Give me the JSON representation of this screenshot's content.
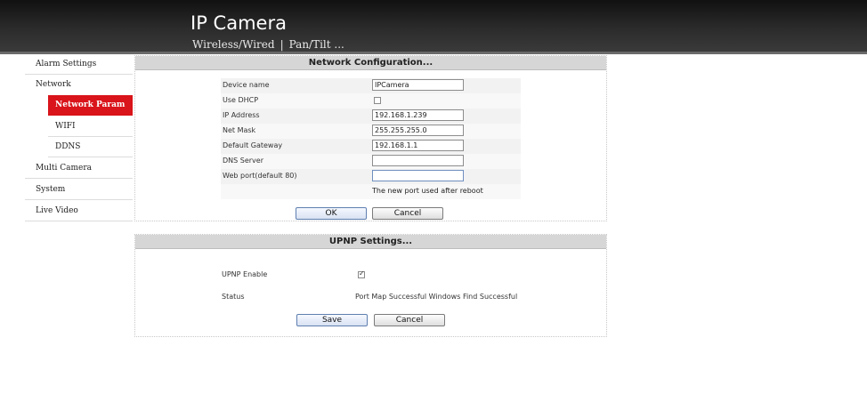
{
  "header": {
    "title": "IP Camera",
    "subnav": [
      "Wireless/Wired",
      "Pan/Tilt ..."
    ],
    "separator": "|"
  },
  "sidebar": {
    "items": [
      {
        "label": "Alarm Settings"
      },
      {
        "label": "Network"
      },
      {
        "label": "Network Param",
        "active": true
      },
      {
        "label": "WIFI"
      },
      {
        "label": "DDNS"
      },
      {
        "label": "Multi Camera"
      },
      {
        "label": "System"
      },
      {
        "label": "Live Video"
      }
    ]
  },
  "network": {
    "title": "Network Configuration...",
    "fields": {
      "device_name": {
        "label": "Device name",
        "value": "IPCamera"
      },
      "use_dhcp": {
        "label": "Use DHCP",
        "checked": false
      },
      "ip_address": {
        "label": "IP Address",
        "value": "192.168.1.239"
      },
      "net_mask": {
        "label": "Net Mask",
        "value": "255.255.255.0"
      },
      "gateway": {
        "label": "Default Gateway",
        "value": "192.168.1.1"
      },
      "dns": {
        "label": "DNS Server",
        "value": ""
      },
      "web_port": {
        "label": "Web port(default 80)",
        "value": ""
      }
    },
    "port_note": "The new port used after reboot",
    "ok_label": "OK",
    "cancel_label": "Cancel"
  },
  "upnp": {
    "title": "UPNP Settings...",
    "enable_label": "UPNP Enable",
    "enabled": true,
    "status_label": "Status",
    "status_value": "Port Map Successful Windows Find Successful",
    "save_label": "Save",
    "cancel_label": "Cancel"
  },
  "colors": {
    "active_nav": "#d9141a",
    "header_bg": "#1e1e1e",
    "panel_title_bg": "#d6d6d6"
  }
}
